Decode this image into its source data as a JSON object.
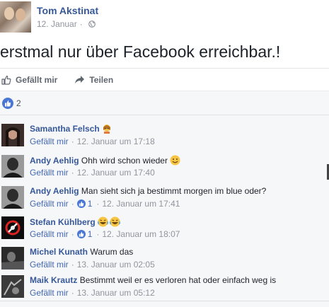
{
  "post": {
    "author": "Tom Akstinat",
    "date": "12. Januar",
    "separator": "·",
    "text": "erstmal nur über Facebook erreichbar.!"
  },
  "actions": {
    "like": "Gefällt mir",
    "share": "Teilen"
  },
  "reactions": {
    "count": "2"
  },
  "comments": [
    {
      "name": "Samantha Felsch",
      "text": "",
      "emoji": "person-emoji",
      "like": "Gefällt mir",
      "time": "12. Januar um 17:18",
      "likes": ""
    },
    {
      "name": "Andy Aehlig",
      "text": "Ohh wird schon wieder",
      "emoji": "smile-emoji",
      "like": "Gefällt mir",
      "time": "12. Januar um 17:40",
      "likes": ""
    },
    {
      "name": "Andy Aehlig",
      "text": "Man sieht sich ja bestimmt morgen im blue oder?",
      "emoji": "",
      "like": "Gefällt mir",
      "time": "12. Januar um 17:41",
      "likes": "1"
    },
    {
      "name": "Stefan Kühlberg",
      "text": "",
      "emoji": "laugh-emoji",
      "like": "Gefällt mir",
      "time": "12. Januar um 18:07",
      "likes": "1"
    },
    {
      "name": "Michel Kunath",
      "text": "Warum das",
      "emoji": "",
      "like": "Gefällt mir",
      "time": "13. Januar um 02:05",
      "likes": ""
    },
    {
      "name": "Maik Krautz",
      "text": "Bestimmt weil er es verloren hat oder einfach weg is",
      "emoji": "",
      "like": "Gefällt mir",
      "time": "13. Januar um 05:12",
      "likes": ""
    }
  ],
  "colors": {
    "link": "#365899",
    "like_blue": "#4a77d6",
    "meta": "#90949c",
    "comment_bg": "#f6f7f9"
  }
}
